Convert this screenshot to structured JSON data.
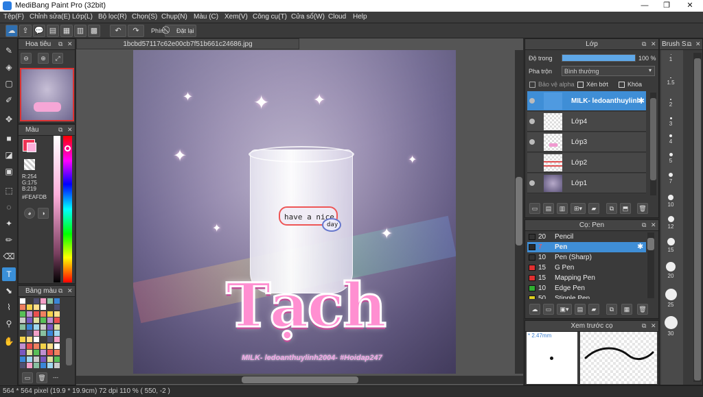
{
  "window": {
    "title": "MediBang Paint Pro (32bit)",
    "minimize": "—",
    "restore": "❐",
    "close": "✕"
  },
  "menu": [
    "Tệp(F)",
    "Chỉnh sửa(E)",
    "Lớp(L)",
    "Bộ lọc(R)",
    "Chọn(S)",
    "Chụp(N)",
    "Màu (C)",
    "Xem(V)",
    "Công cụ(T)",
    "Cửa sổ(W)",
    "Cloud",
    "Help"
  ],
  "toolbar": {
    "snap_label": "Phím",
    "reset_label": "Đặt lại"
  },
  "navigator": {
    "title": "Hoa tiêu"
  },
  "color_panel": {
    "title": "Màu",
    "r": "R:254",
    "g": "G:175",
    "b": "B:219",
    "hex": "#FEAFDB",
    "primary": "#FEAFDB",
    "accent": "#ee3355"
  },
  "palette_panel": {
    "title": "Bảng màu",
    "footer": "---"
  },
  "document": {
    "tab_title": "1bcbd57117c62e00cb7f51b661c24686.jpg"
  },
  "artwork": {
    "jar_text_1": "have a nice",
    "jar_text_2": "day",
    "big_title": "Tạch",
    "credit": "MILK- ledoanthuylinh2004- #Hoidap247"
  },
  "layer_panel": {
    "title": "Lớp",
    "opacity_label": "Độ trong",
    "opacity_value": "100 %",
    "opacity_fraction": 1.0,
    "blend_label": "Pha trộn",
    "blend_value": "Bình thường",
    "protect_alpha": "Bảo vệ alpha",
    "clip": "Xén bớt",
    "lock": "Khóa",
    "layers": [
      {
        "name": "MILK- ledoanthuylinh2004",
        "selected": true
      },
      {
        "name": "Lớp4",
        "selected": false
      },
      {
        "name": "Lớp3",
        "selected": false
      },
      {
        "name": "Lớp2",
        "selected": false
      },
      {
        "name": "Lớp1",
        "selected": false
      }
    ]
  },
  "brush_panel": {
    "title": "Cọ: Pen",
    "brushes": [
      {
        "size": "20",
        "name": "Pencil",
        "color": "#333333"
      },
      {
        "size": "7",
        "name": "Pen",
        "color": "#2a2a2a",
        "selected": true
      },
      {
        "size": "10",
        "name": "Pen (Sharp)",
        "color": "#333333"
      },
      {
        "size": "15",
        "name": "G Pen",
        "color": "#e03030"
      },
      {
        "size": "15",
        "name": "Mapping Pen",
        "color": "#e03030"
      },
      {
        "size": "10",
        "name": "Edge Pen",
        "color": "#30b030"
      },
      {
        "size": "50",
        "name": "Stipple Pen",
        "color": "#e0d020"
      }
    ]
  },
  "preview_panel": {
    "title": "Xem trước cọ",
    "size": "* 2.47mm"
  },
  "brush_size_panel": {
    "title": "Brush S...",
    "sizes": [
      "1",
      "1.5",
      "2",
      "3",
      "4",
      "5",
      "7",
      "10",
      "12",
      "15",
      "20",
      "25",
      "30"
    ]
  },
  "status": {
    "text": "564 * 564 pixel  (19.9 * 19.9cm)  72 dpi  110 %  ( 550, -2 )"
  }
}
